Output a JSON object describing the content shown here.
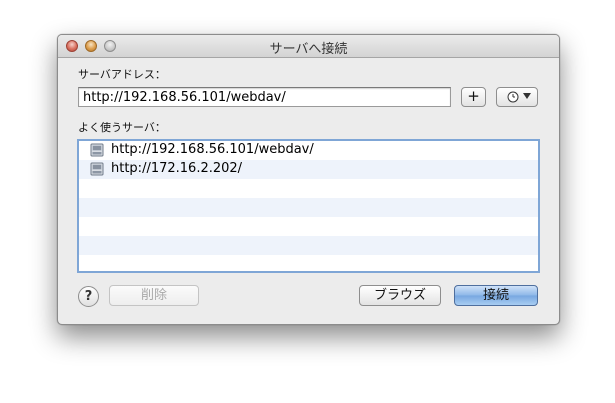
{
  "window": {
    "title": "サーバへ接続"
  },
  "server_address": {
    "label": "サーバアドレス：",
    "value": "http://192.168.56.101/webdav/",
    "add_label": "+"
  },
  "favorites": {
    "label": "よく使うサーバ：",
    "items": [
      {
        "label": "http://192.168.56.101/webdav/",
        "icon": "server-icon"
      },
      {
        "label": "http://172.16.2.202/",
        "icon": "server-icon"
      }
    ]
  },
  "footer": {
    "help_label": "?",
    "delete_label": "削除",
    "browse_label": "ブラウズ",
    "connect_label": "接続"
  },
  "colors": {
    "accent": "#7fa6d6",
    "row_alt": "#eef3fb",
    "window_bg": "#ececec"
  }
}
